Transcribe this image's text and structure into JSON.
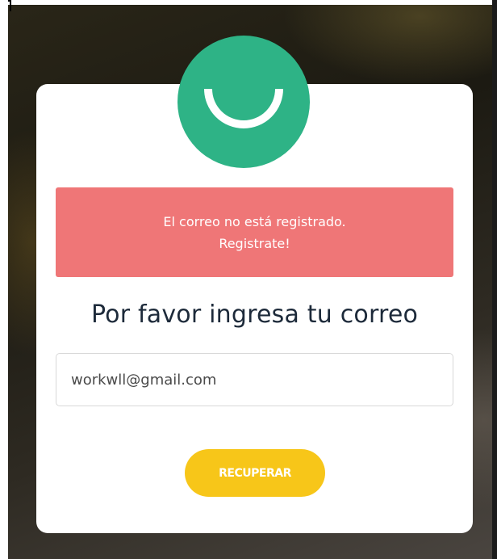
{
  "logo": {
    "icon": "smile-icon",
    "color": "#2eb386"
  },
  "alert": {
    "line1": "El correo no está registrado.",
    "line2": "Registrate!",
    "color": "#ef7677"
  },
  "form": {
    "title": "Por favor ingresa tu correo",
    "email_value": "workwll@gmail.com",
    "submit_label": "RECUPERAR",
    "button_color": "#f7c619"
  }
}
